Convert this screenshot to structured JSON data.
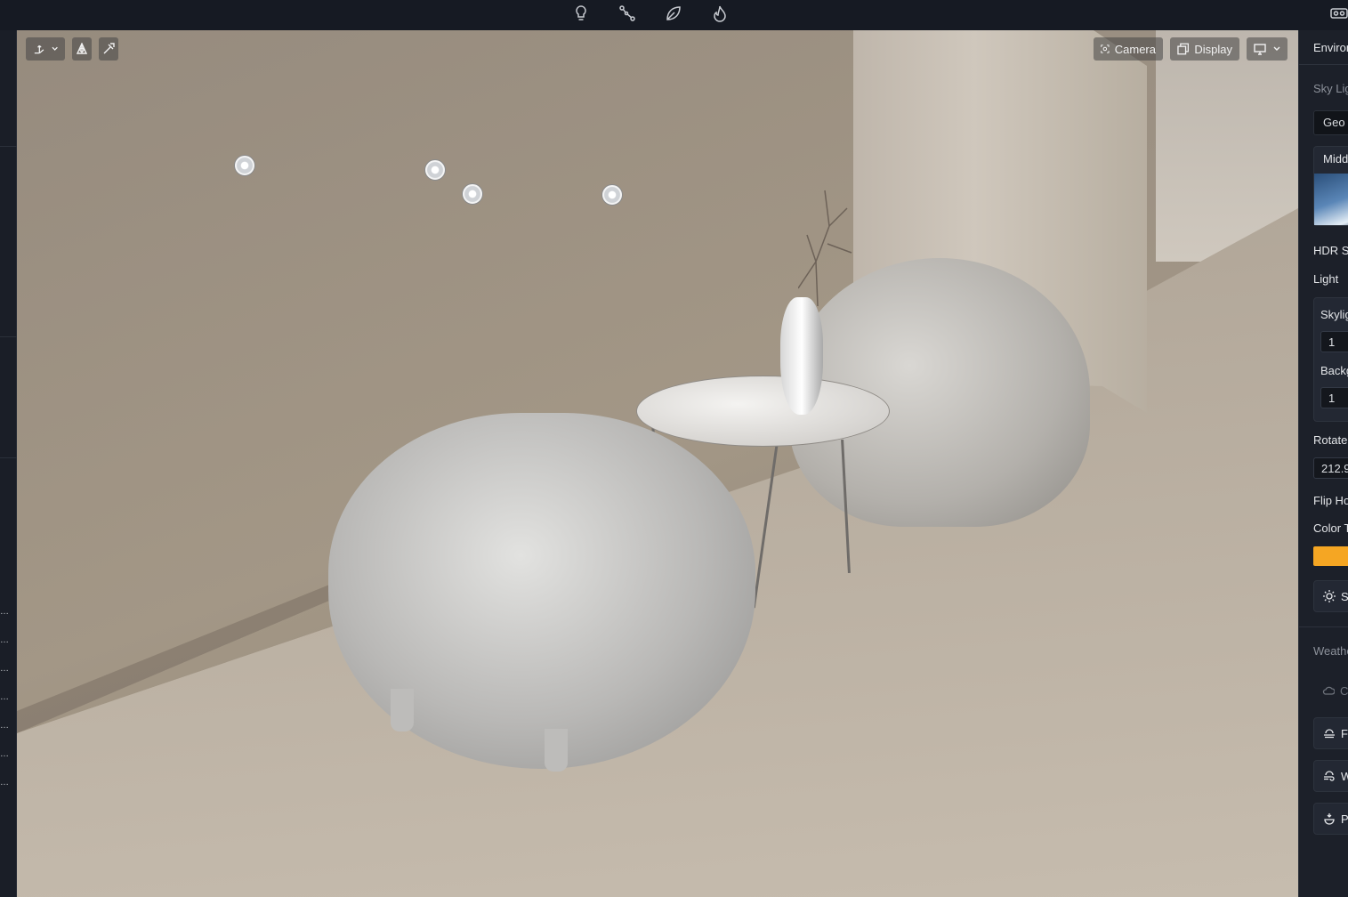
{
  "topbar": {
    "icons": [
      "lightbulb-icon",
      "path-nodes-icon",
      "leaf-icon",
      "flame-icon",
      "vr-headset-icon"
    ]
  },
  "viewport": {
    "left_tools": [
      "transform-dropdown-icon",
      "pivot-icon",
      "snap-icon"
    ],
    "camera_label": "Camera",
    "display_label": "Display",
    "view_dropdown_icon": "viewport-layout-icon"
  },
  "right_panel": {
    "title": "Environment",
    "sky_light_label": "Sky Light",
    "geo_tab": "Geo",
    "midday_label": "Midday",
    "hdr_sky_label": "HDR Sky",
    "light_label": "Light",
    "skylight_intensity_label": "Skylight",
    "skylight_value": "1",
    "background_label": "Background",
    "background_value": "1",
    "rotate_label": "Rotate",
    "rotate_value": "212.9",
    "flip_label": "Flip Horizontal",
    "color_temp_label": "Color Temperature",
    "color_swatch": "#f5a623",
    "sun_label": "Sun",
    "weather_label": "Weather",
    "weather_items": [
      {
        "label": "Clear",
        "icon": "cloud-icon",
        "active": false
      },
      {
        "label": "Fog",
        "icon": "fog-icon",
        "active": true
      },
      {
        "label": "Wind",
        "icon": "wind-icon",
        "active": true
      },
      {
        "label": "Precipitation",
        "icon": "precipitation-icon",
        "active": true
      }
    ]
  }
}
